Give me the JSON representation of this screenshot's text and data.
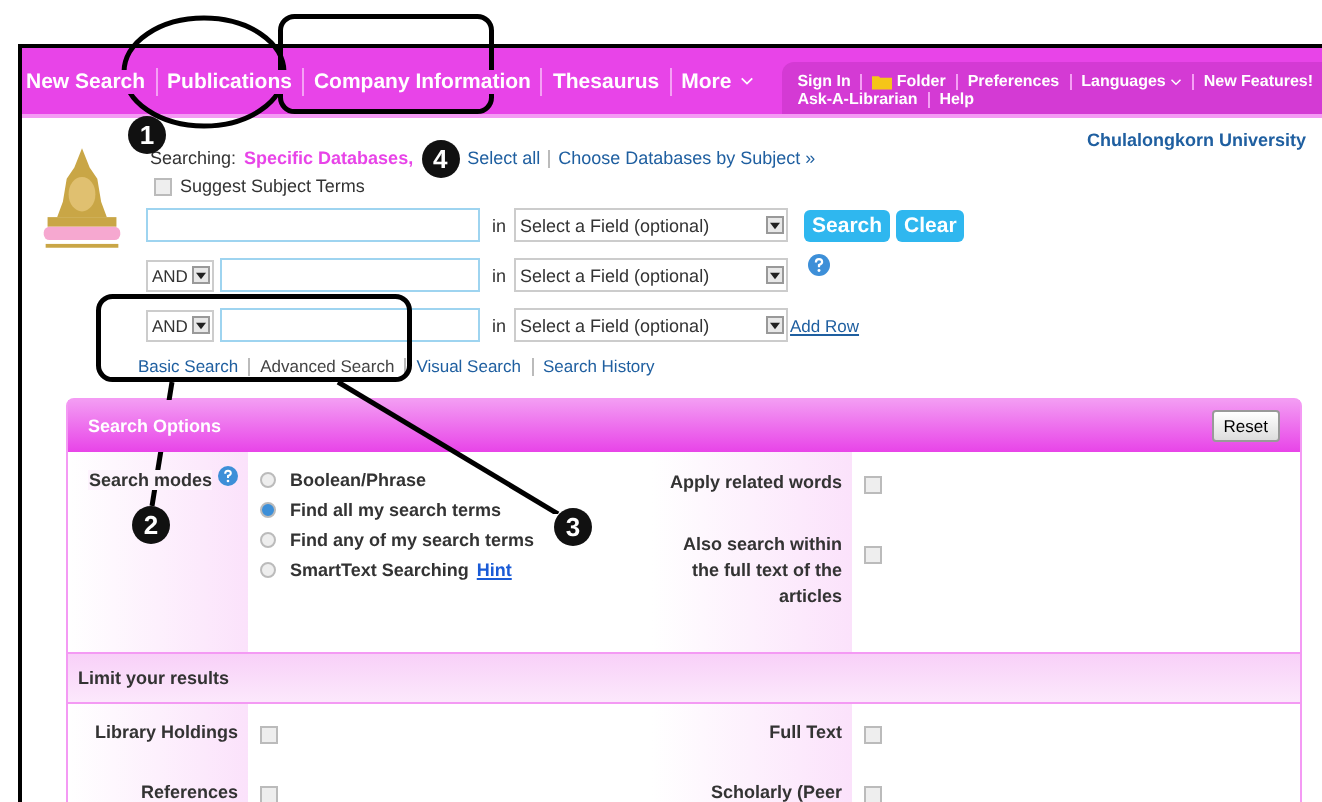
{
  "nav": {
    "items": [
      {
        "label": "New Search",
        "kind": "link"
      },
      {
        "label": "Publications",
        "kind": "link"
      },
      {
        "label": "Company Information",
        "kind": "link"
      },
      {
        "label": "Thesaurus",
        "kind": "link"
      },
      {
        "label": "More",
        "kind": "dropdown"
      }
    ],
    "account_lines": [
      [
        {
          "label": "Sign In",
          "kind": "link"
        },
        {
          "label": "Folder",
          "kind": "folder"
        },
        {
          "label": "Preferences",
          "kind": "link"
        },
        {
          "label": "Languages",
          "kind": "dropdown"
        },
        {
          "label": "New Features!",
          "kind": "link"
        }
      ],
      [
        {
          "label": "Ask-A-Librarian",
          "kind": "link"
        },
        {
          "label": "Help",
          "kind": "link"
        }
      ]
    ]
  },
  "search": {
    "searching_label": "Searching:",
    "databases": "Specific Databases,",
    "select_all": "Select all",
    "choose": "Choose Databases by Subject »",
    "institution": "Chulalongkorn University",
    "suggest": {
      "label": "Suggest Subject Terms",
      "checked": false
    },
    "rows": [
      {
        "in": "in",
        "field": "Select a Field (optional)"
      },
      {
        "operator": "AND",
        "in": "in",
        "field": "Select a Field (optional)"
      },
      {
        "operator": "AND",
        "in": "in",
        "field": "Select a Field (optional)"
      }
    ],
    "buttons": [
      "Search",
      "Clear"
    ],
    "add_row": "Add Row",
    "modes": [
      {
        "label": "Basic Search",
        "selected": false
      },
      {
        "label": "Advanced Search",
        "selected": true
      },
      {
        "label": "Visual Search",
        "selected": false
      },
      {
        "label": "Search History",
        "selected": false
      }
    ]
  },
  "options": {
    "title": "Search Options",
    "reset": "Reset",
    "modes_label": "Search modes",
    "modes": [
      {
        "label": "Boolean/Phrase",
        "selected": false
      },
      {
        "label": "Find all my search terms",
        "selected": true
      },
      {
        "label": "Find any of my search terms",
        "selected": false
      },
      {
        "label": "SmartText Searching",
        "selected": false,
        "hint": "Hint"
      }
    ],
    "right": [
      {
        "label": "Apply related words",
        "checked": false
      },
      {
        "label": "Also search within the full text of the articles",
        "checked": false
      }
    ],
    "limit_title": "Limit your results",
    "limits": [
      {
        "label": "Library Holdings",
        "checked": false
      },
      {
        "label": "Full Text",
        "checked": false
      },
      {
        "label": "References",
        "checked": false
      },
      {
        "label": "Scholarly (Peer",
        "checked": false
      }
    ]
  },
  "annotations": [
    {
      "number": "1"
    },
    {
      "number": "4"
    },
    {
      "number": "2"
    },
    {
      "number": "3"
    }
  ]
}
